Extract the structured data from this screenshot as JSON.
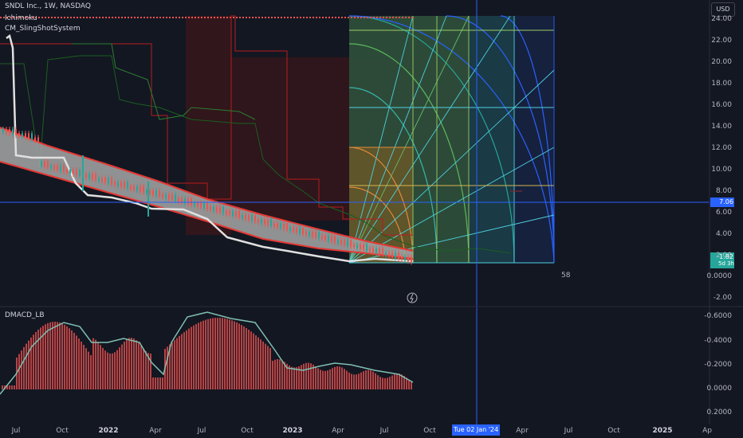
{
  "symbol": {
    "title": "SNDL Inc., 1W, NASDAQ",
    "indicators": [
      "Ichimoku",
      "CM_SlingShotSystem"
    ],
    "lower_pane": "DMACD_LB"
  },
  "toolbar": {
    "currency": "USD"
  },
  "price_axis": {
    "labels": [
      "24.00",
      "22.00",
      "20.00",
      "18.00",
      "16.00",
      "14.00",
      "12.00",
      "10.00",
      "8.00",
      "6.00",
      "4.00",
      "2.00",
      "0.0000",
      "-2.00"
    ]
  },
  "macd_axis": {
    "labels": [
      "-0.6000",
      "-0.4000",
      "-0.2000",
      "0.0000",
      "0.2000"
    ]
  },
  "time_axis": {
    "labels": [
      "Jul",
      "Oct",
      "2022",
      "Apr",
      "Jul",
      "Oct",
      "2023",
      "Apr",
      "Jul",
      "Oct",
      "Apr",
      "Jul",
      "Oct",
      "2025",
      "Ap"
    ],
    "crosshair_label": "Tue 02 Jan '24"
  },
  "price_tags": {
    "crosshair_price": "7.06",
    "last_price": "1.82",
    "last_price_sub": "5d 3h"
  },
  "annotation": {
    "bar_count": "58"
  },
  "colors": {
    "background": "#131722",
    "up": "#26a69a",
    "down": "#ef5350",
    "crosshair": "#2962ff",
    "ribbon_fill": "#9e9e9e",
    "ribbon_edge": "#e53935"
  }
}
